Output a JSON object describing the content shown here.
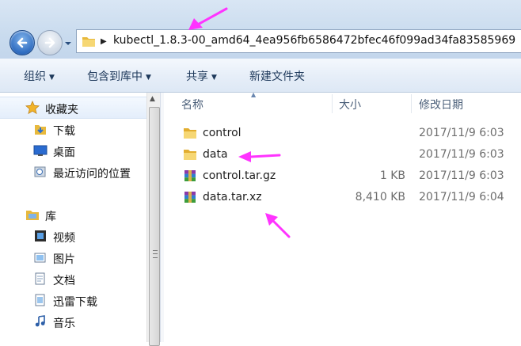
{
  "address": {
    "path": "kubectl_1.8.3-00_amd64_4ea956fb6586472bfec46f099ad34fa83585969"
  },
  "toolbar": {
    "organize": "组织",
    "include_library": "包含到库中",
    "share": "共享",
    "new_folder": "新建文件夹"
  },
  "nav": {
    "favorites": {
      "label": "收藏夹",
      "items": [
        {
          "label": "下载",
          "icon": "download-folder-icon"
        },
        {
          "label": "桌面",
          "icon": "desktop-icon"
        },
        {
          "label": "最近访问的位置",
          "icon": "recent-places-icon"
        }
      ]
    },
    "libraries": {
      "label": "库",
      "items": [
        {
          "label": "视频",
          "icon": "video-library-icon"
        },
        {
          "label": "图片",
          "icon": "pictures-library-icon"
        },
        {
          "label": "文档",
          "icon": "documents-library-icon"
        },
        {
          "label": "迅雷下载",
          "icon": "thunder-download-icon"
        },
        {
          "label": "音乐",
          "icon": "music-library-icon"
        }
      ]
    }
  },
  "columns": {
    "name": "名称",
    "size": "大小",
    "modified": "修改日期"
  },
  "files": [
    {
      "name": "control",
      "size": "",
      "date": "2017/11/9 6:03",
      "icon": "folder-icon"
    },
    {
      "name": "data",
      "size": "",
      "date": "2017/11/9 6:03",
      "icon": "folder-icon"
    },
    {
      "name": "control.tar.gz",
      "size": "1 KB",
      "date": "2017/11/9 6:03",
      "icon": "archive-icon"
    },
    {
      "name": "data.tar.xz",
      "size": "8,410 KB",
      "date": "2017/11/9 6:04",
      "icon": "archive-icon"
    }
  ],
  "colors": {
    "annotation_arrow": "#ff33ff",
    "folder": "#f3c94a",
    "nav_button": "#2f6cc0"
  }
}
